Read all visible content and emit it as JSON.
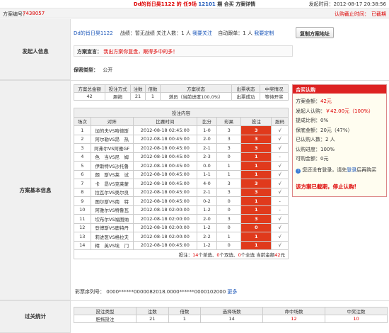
{
  "header": {
    "title_prefix": "Dd的肖日昊1122 的 任9场",
    "issue": "12101",
    "title_suffix": "期 合买 方案详情",
    "publish_time": "发起时间：2012-08-17 20:38:56"
  },
  "subheader": {
    "plan_no_label": "方案编号：",
    "plan_no": "7438057",
    "deadline_label": "认购截止时间：",
    "deadline_status": "已截期"
  },
  "initiator": {
    "section_label": "发起人信息",
    "username": "Dd的肖日昊1122",
    "record_label": "战绩：",
    "record_value": "暂无战绩",
    "followers_label": "关注人数：",
    "followers": "1 人",
    "follow_link": "我要关注",
    "autofollow_label": "自动跟单：",
    "autofollow": "1 人",
    "custom_link": "我要定制",
    "copy_button": "复制方案地址",
    "slogan_label": "方案宣言：",
    "slogan": "我出方案你复盘，跟得多中的多！",
    "privacy_label": "保密类型：",
    "privacy": "公开"
  },
  "plan": {
    "section_label": "方案基本信息",
    "summary_headers": [
      "方案总金额",
      "投注方式",
      "注数",
      "倍数",
      "方案状态",
      "出票状态",
      "中奖情况"
    ],
    "summary_row": [
      "42",
      "胆拖",
      "21",
      "1",
      "满员（当前进度100.0%）",
      "出票成功",
      "等待开奖"
    ],
    "bet_content_title": "投注内容",
    "match_headers": [
      "场次",
      "对阵",
      "比赛时间",
      "比分",
      "彩果",
      "投注",
      "胆码"
    ],
    "matches": [
      [
        "1",
        "加的夫VS哈德斯",
        "2012-08-18 02:45:00",
        "1-0",
        "3",
        "3",
        "√"
      ],
      [
        "2",
        "阿尔勒VS昂　热",
        "2012-08-18 00:45:00",
        "2-0",
        "3",
        "3",
        "√"
      ],
      [
        "3",
        "阿弗尔VS阿雅GF",
        "2012-08-18 00:45:00",
        "2-1",
        "3",
        "3",
        "√"
      ],
      [
        "4",
        "色　当VS尼　姆",
        "2012-08-18 00:45:00",
        "2-3",
        "0",
        "1",
        "-"
      ],
      [
        "5",
        "伊斯特VS沙托鲁",
        "2012-08-18 00:45:00",
        "0-0",
        "1",
        "1",
        "√"
      ],
      [
        "6",
        "朗　斯VS莱　试",
        "2012-08-18 00:45:00",
        "1-1",
        "1",
        "1",
        "√"
      ],
      [
        "7",
        "卡　昂VS克莱蒙",
        "2012-08-18 00:45:00",
        "4-0",
        "3",
        "3",
        "√"
      ],
      [
        "8",
        "拉瓦尔VS奥尔良",
        "2012-08-18 00:45:00",
        "2-1",
        "3",
        "3",
        "√"
      ],
      [
        "9",
        "图尔斯VS南　特",
        "2012-08-18 00:45:00",
        "0-2",
        "0",
        "1",
        "-"
      ],
      [
        "10",
        "阿雅尔VS特鲁瓦",
        "2012-08-18 02:00:00",
        "1-2",
        "0",
        "1",
        "-"
      ],
      [
        "11",
        "坎布尔VS福图纳",
        "2012-08-18 02:00:00",
        "2-0",
        "3",
        "3",
        "√"
      ],
      [
        "12",
        "登博斯VS鹿特丹",
        "2012-08-18 02:00:00",
        "1-2",
        "0",
        "0",
        "√"
      ],
      [
        "13",
        "莉进医VS格拉夫",
        "2012-08-18 02:00:00",
        "2-2",
        "1",
        "1",
        "√"
      ],
      [
        "14",
        "精　英VS埃　门",
        "2012-08-18 00:45:00",
        "1-2",
        "0",
        "1",
        "√"
      ]
    ],
    "bet_summary": {
      "prefix": "投注：",
      "singles": "14",
      "singles_label": "个单选、",
      "doubles": "0",
      "doubles_label": "个双选、",
      "triples": "0",
      "triples_label": "个全选 当前金额",
      "amount": "42",
      "suffix": "元"
    },
    "ticket_label": "彩票序列号：",
    "ticket_value": "0000******0000082018.0000******0000102000",
    "ticket_more": "更多"
  },
  "hemai": {
    "title": "合买认购",
    "lines": [
      {
        "label": "方案金额：",
        "value": "42元"
      },
      {
        "label": "发起人认购：",
        "value": "￥42.00元（100%）"
      },
      {
        "label": "提成比例：",
        "value": "0%"
      },
      {
        "label": "保底金额：",
        "value": "20元（47%）"
      },
      {
        "label": "已认购人数：",
        "value": "2 人"
      },
      {
        "label": "认购进度：",
        "value": "100%"
      },
      {
        "label": "可购金额：",
        "value": "0元"
      }
    ],
    "login_text": "您还没有登录，请先",
    "login_link": "登录",
    "login_suffix": "后再购买",
    "closed_notice": "该方案已截期，停止认购!"
  },
  "stats": {
    "section_label": "过关统计",
    "headers": [
      "投注类型",
      "注数",
      "倍数",
      "选择场数",
      "命中场数",
      "中奖注数"
    ],
    "row": [
      "胆拖投注",
      "21",
      "1",
      "14",
      "12",
      "10"
    ]
  },
  "colors": {
    "accent_red": "#d00",
    "bet_cell": "#e03a1c",
    "link_blue": "#1a55b8"
  }
}
